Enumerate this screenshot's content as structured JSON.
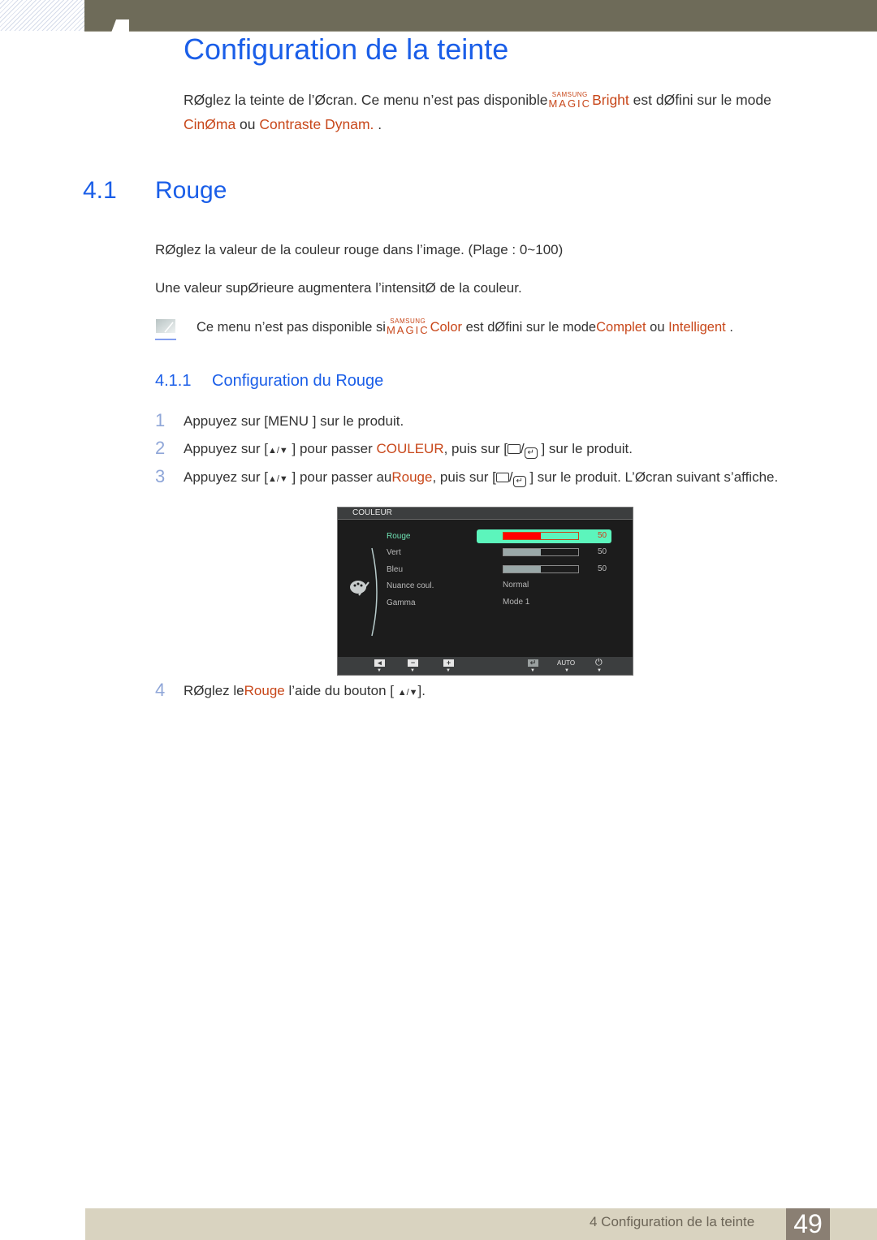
{
  "header": {
    "chapter_title": "Configuration de la teinte"
  },
  "intro": {
    "text_before": "RØglez la teinte de l’Øcran. Ce menu n’est pas disponible",
    "magic_top": "SAMSUNG",
    "magic_bottom": "MAGIC",
    "magic_product": "Bright",
    "text_middle": " est dØfini sur le mode",
    "mode_1": "CinØma",
    "conjunction": " ou ",
    "mode_2": "Contraste Dynam.",
    "text_end": " ."
  },
  "section": {
    "number": "4.1",
    "title": "Rouge",
    "paragraphs": [
      "RØglez la valeur de la couleur rouge dans l’image. (Plage : 0~100)",
      "Une valeur supØrieure augmentera l’intensitØ de la couleur."
    ],
    "note": {
      "text_before": "Ce menu n’est pas disponible si",
      "magic_top": "SAMSUNG",
      "magic_bottom": "MAGIC",
      "magic_product": "Color",
      "text_middle": " est dØfini sur le mode",
      "mode_1": "Complet",
      "conjunction": "  ou ",
      "mode_2": "Intelligent",
      "text_end": " ."
    }
  },
  "subsection": {
    "number": "4.1.1",
    "title": "Configuration du Rouge"
  },
  "steps": [
    {
      "num": "1",
      "a": "Appuyez sur [",
      "key": "MENU",
      "b": " ] sur le produit."
    },
    {
      "num": "2",
      "a": "Appuyez sur [",
      "arrows": "▲/▼",
      "b": " ] pour passer  ",
      "target": "COULEUR",
      "c": ", puis sur [",
      "d": " ] sur le produit."
    },
    {
      "num": "3",
      "a": "Appuyez sur [",
      "arrows": "▲/▼",
      "b": " ] pour passer au",
      "target": "Rouge",
      "c": ", puis sur [",
      "d": " ] sur le produit. L’Øcran suivant s’affiche."
    },
    {
      "num": "4",
      "a": "RØglez le",
      "target": "Rouge",
      "b": "  l’aide du bouton [ ",
      "arrows": "▲/▼",
      "c": "]."
    }
  ],
  "osd": {
    "title": "COULEUR",
    "items": [
      {
        "label": "Rouge",
        "value": "50",
        "level": 50,
        "selected": true
      },
      {
        "label": "Vert",
        "value": "50",
        "level": 50,
        "selected": false
      },
      {
        "label": "Bleu",
        "value": "50",
        "level": 50,
        "selected": false
      },
      {
        "label": "Nuance coul.",
        "option": "Normal"
      },
      {
        "label": "Gamma",
        "option": "Mode 1"
      }
    ],
    "footer": {
      "left_icon": "left-arrow-icon",
      "minus_icon": "minus-icon",
      "plus_icon": "plus-icon",
      "enter_icon": "enter-icon",
      "auto_label": "AUTO",
      "power_icon": "power-icon"
    }
  },
  "footer": {
    "text": "4 Configuration de la teinte",
    "page": "49"
  },
  "colors": {
    "heading_blue": "#1a5ee8",
    "accent_orange": "#c8471a",
    "header_bar": "#6e6b59",
    "footer_bar": "#d9d3c0",
    "page_box": "#8a7f73",
    "osd_highlight": "#5cf5bc"
  }
}
